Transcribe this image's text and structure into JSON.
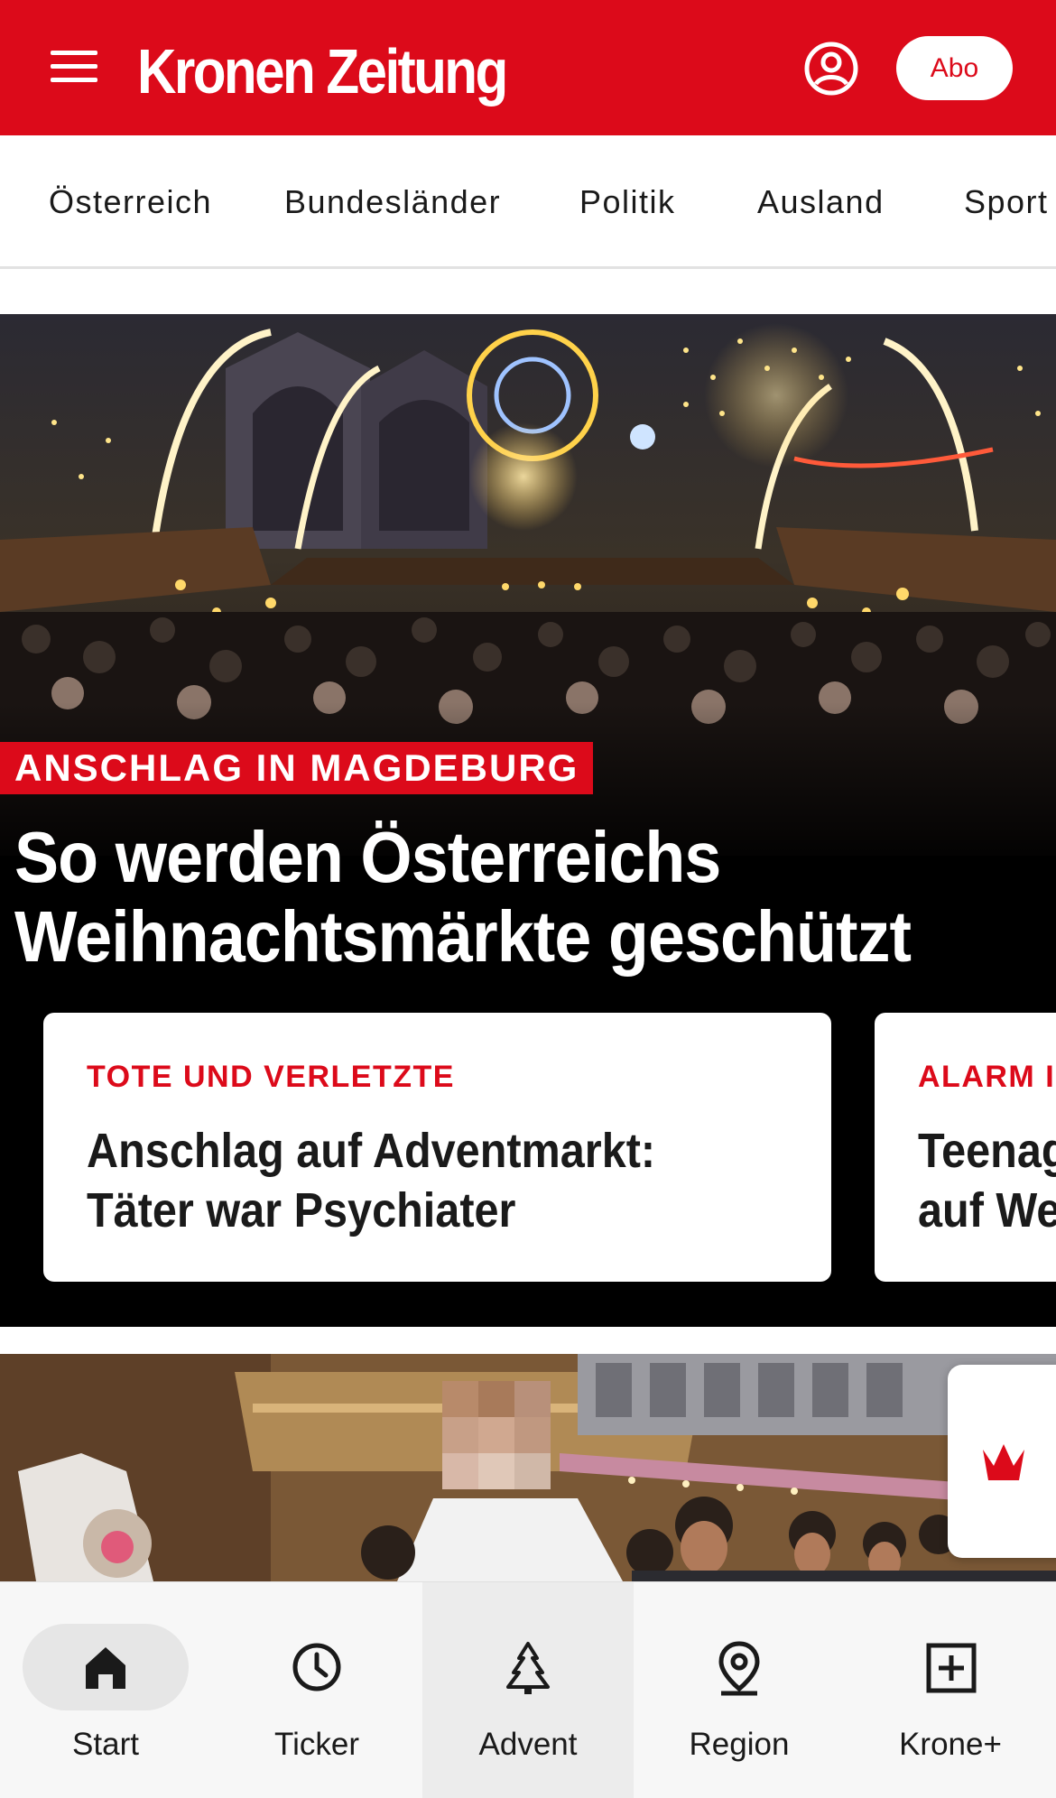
{
  "header": {
    "logo_text": "Kronen Zeitung",
    "abo_label": "Abo",
    "brand_color": "#dc0a1a"
  },
  "categories": [
    "Österreich",
    "Bundesländer",
    "Politik",
    "Ausland",
    "Sport"
  ],
  "hero": {
    "kicker": "ANSCHLAG IN MAGDEBURG",
    "headline": "So werden Österreichs Weihnachtsmärkte geschützt"
  },
  "cards": [
    {
      "kicker": "TOTE UND VERLETZTE",
      "title_line1": "Anschlag auf Adventmarkt:",
      "title_line2": "Täter war Psychiater"
    },
    {
      "kicker": "ALARM I",
      "title_line1": "Teenag",
      "title_line2": "auf We"
    }
  ],
  "bottom_nav": {
    "items": [
      {
        "label": "Start",
        "icon": "home-icon"
      },
      {
        "label": "Ticker",
        "icon": "clock-icon"
      },
      {
        "label": "Advent",
        "icon": "tree-icon"
      },
      {
        "label": "Region",
        "icon": "location-pin-icon"
      },
      {
        "label": "Krone+",
        "icon": "plus-box-icon"
      }
    ]
  }
}
